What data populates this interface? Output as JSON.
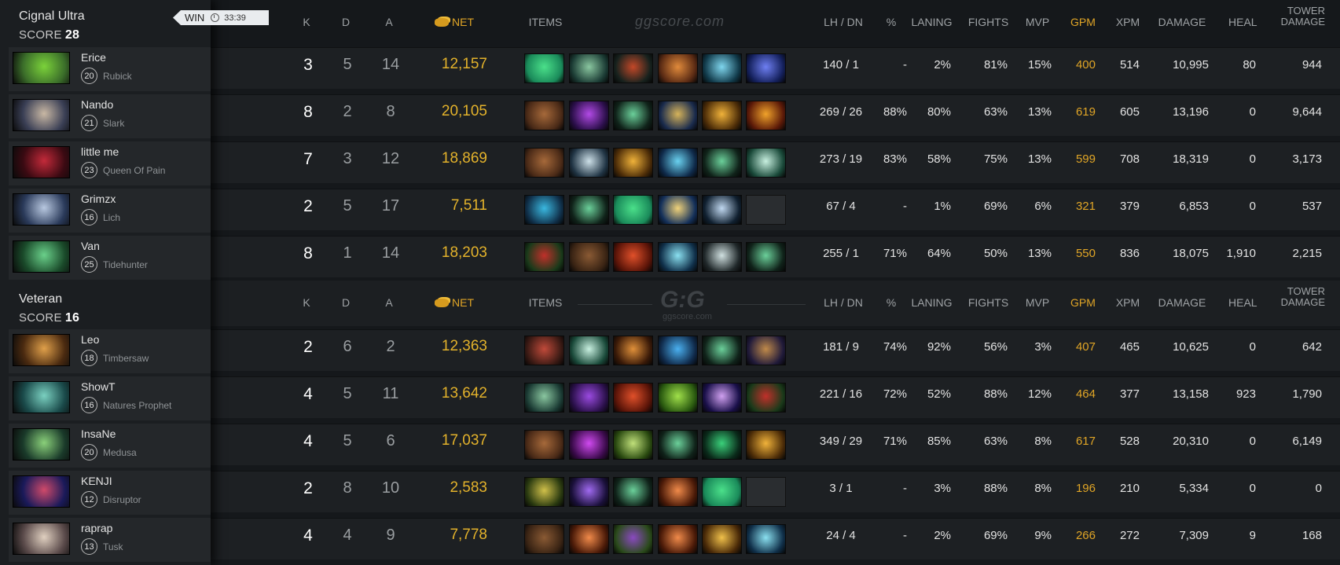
{
  "teams": [
    {
      "name": "Cignal Ultra",
      "score_label": "SCORE",
      "score": "28",
      "result": "WIN",
      "duration": "33:39",
      "players": [
        {
          "name": "Erice",
          "level": "20",
          "hero": "Rubick",
          "k": "3",
          "d": "5",
          "a": "14",
          "net": "12,157",
          "lhdn": "140  /  1",
          "pct": "-",
          "laning": "2%",
          "fights": "81%",
          "mvp": "15%",
          "gpm": "400",
          "xpm": "514",
          "damage": "10,995",
          "heal": "80",
          "tower": "944",
          "avatar_colors": [
            "#3b6e2a",
            "#7bd23a"
          ],
          "items": [
            [
              "#1a8a5a",
              "#4be08a"
            ],
            [
              "#1b3b34",
              "#8ac7a0"
            ],
            [
              "#17221e",
              "#c34828"
            ],
            [
              "#5b2b14",
              "#e08a3b"
            ],
            [
              "#113a4a",
              "#7fd6ee"
            ],
            [
              "#14205c",
              "#6e7ff2"
            ]
          ]
        },
        {
          "name": "Nando",
          "level": "21",
          "hero": "Slark",
          "k": "8",
          "d": "2",
          "a": "8",
          "net": "20,105",
          "lhdn": "269  /  26",
          "pct": "88%",
          "laning": "80%",
          "fights": "63%",
          "mvp": "13%",
          "gpm": "619",
          "xpm": "605",
          "damage": "13,196",
          "heal": "0",
          "tower": "9,644",
          "avatar_colors": [
            "#3a3f55",
            "#c9b8a4"
          ],
          "items": [
            [
              "#4a2a17",
              "#a6693a"
            ],
            [
              "#2b0f4a",
              "#b24ae6"
            ],
            [
              "#10231a",
              "#6bd09a"
            ],
            [
              "#1a2b4d",
              "#d6b35a"
            ],
            [
              "#4d2d08",
              "#f0b23a"
            ],
            [
              "#5c1a08",
              "#f0a22a"
            ]
          ]
        },
        {
          "name": "little me",
          "level": "23",
          "hero": "Queen Of Pain",
          "k": "7",
          "d": "3",
          "a": "12",
          "net": "18,869",
          "lhdn": "273  /  19",
          "pct": "83%",
          "laning": "58%",
          "fights": "75%",
          "mvp": "13%",
          "gpm": "599",
          "xpm": "708",
          "damage": "18,319",
          "heal": "0",
          "tower": "3,173",
          "avatar_colors": [
            "#3a0a12",
            "#c32a3a"
          ],
          "items": [
            [
              "#4a2a17",
              "#a6693a"
            ],
            [
              "#203444",
              "#cde0e8"
            ],
            [
              "#4d2d08",
              "#f0b23a"
            ],
            [
              "#0f2a4a",
              "#6ad2f0"
            ],
            [
              "#10231a",
              "#6bd09a"
            ],
            [
              "#1a4a3a",
              "#c8f0e0"
            ]
          ]
        },
        {
          "name": "Grimzx",
          "level": "16",
          "hero": "Lich",
          "k": "2",
          "d": "5",
          "a": "17",
          "net": "7,511",
          "lhdn": "67  /  4",
          "pct": "-",
          "laning": "1%",
          "fights": "69%",
          "mvp": "6%",
          "gpm": "321",
          "xpm": "379",
          "damage": "6,853",
          "heal": "0",
          "tower": "537",
          "avatar_colors": [
            "#2a3a5a",
            "#b8c8e0"
          ],
          "items": [
            [
              "#10304a",
              "#3ab8e0"
            ],
            [
              "#10231a",
              "#6bd09a"
            ],
            [
              "#1a8a5a",
              "#4be08a"
            ],
            [
              "#14305a",
              "#f0d27a"
            ],
            [
              "#102030",
              "#c0d8f0"
            ],
            [
              "#2a2d30",
              "#2a2d30"
            ]
          ],
          "empty_last": true
        },
        {
          "name": "Van",
          "level": "25",
          "hero": "Tidehunter",
          "k": "8",
          "d": "1",
          "a": "14",
          "net": "18,203",
          "lhdn": "255  /  1",
          "pct": "71%",
          "laning": "64%",
          "fights": "50%",
          "mvp": "13%",
          "gpm": "550",
          "xpm": "836",
          "damage": "18,075",
          "heal": "1,910",
          "tower": "2,215",
          "avatar_colors": [
            "#1a4a2a",
            "#6ad08a"
          ],
          "items": [
            [
              "#1a3a1a",
              "#c0302a"
            ],
            [
              "#3a2414",
              "#8a5a34"
            ],
            [
              "#5a1408",
              "#e0502a"
            ],
            [
              "#10304a",
              "#8ae0f0"
            ],
            [
              "#20282a",
              "#d0e0e0"
            ],
            [
              "#10231a",
              "#6bd09a"
            ]
          ]
        }
      ]
    },
    {
      "name": "Veteran",
      "score_label": "SCORE",
      "score": "16",
      "players": [
        {
          "name": "Leo",
          "level": "18",
          "hero": "Timbersaw",
          "k": "2",
          "d": "6",
          "a": "2",
          "net": "12,363",
          "lhdn": "181  /  9",
          "pct": "74%",
          "laning": "92%",
          "fights": "56%",
          "mvp": "3%",
          "gpm": "407",
          "xpm": "465",
          "damage": "10,625",
          "heal": "0",
          "tower": "642",
          "avatar_colors": [
            "#4a2a10",
            "#e0a04a"
          ],
          "items": [
            [
              "#3a1a14",
              "#c04a3a"
            ],
            [
              "#1a4a3a",
              "#c8f0e0"
            ],
            [
              "#3a1a08",
              "#e0903a"
            ],
            [
              "#102a4a",
              "#4ab0f0"
            ],
            [
              "#10231a",
              "#6bd09a"
            ],
            [
              "#201a3a",
              "#c08a4a"
            ]
          ]
        },
        {
          "name": "ShowT",
          "level": "16",
          "hero": "Natures Prophet",
          "k": "4",
          "d": "5",
          "a": "11",
          "net": "13,642",
          "lhdn": "221  /  16",
          "pct": "72%",
          "laning": "52%",
          "fights": "88%",
          "mvp": "12%",
          "gpm": "464",
          "xpm": "377",
          "damage": "13,158",
          "heal": "923",
          "tower": "1,790",
          "avatar_colors": [
            "#1a4a4a",
            "#7ad0c0"
          ],
          "items": [
            [
              "#1b3b34",
              "#8ac7a0"
            ],
            [
              "#2a104a",
              "#9a4ae0"
            ],
            [
              "#5a1408",
              "#e0502a"
            ],
            [
              "#2a5a10",
              "#a0e04a"
            ],
            [
              "#1a104a",
              "#d0a0f0"
            ],
            [
              "#1a3a1a",
              "#c0302a"
            ]
          ]
        },
        {
          "name": "InsaNe",
          "level": "20",
          "hero": "Medusa",
          "k": "4",
          "d": "5",
          "a": "6",
          "net": "17,037",
          "lhdn": "349  /  29",
          "pct": "71%",
          "laning": "85%",
          "fights": "63%",
          "mvp": "8%",
          "gpm": "617",
          "xpm": "528",
          "damage": "20,310",
          "heal": "0",
          "tower": "6,149",
          "avatar_colors": [
            "#1a3a2a",
            "#8ad07a"
          ],
          "items": [
            [
              "#4a2a17",
              "#a6693a"
            ],
            [
              "#3a0a4a",
              "#d04af0"
            ],
            [
              "#2a4a10",
              "#c0e07a"
            ],
            [
              "#10231a",
              "#6bd09a"
            ],
            [
              "#0a2a1a",
              "#3ad07a"
            ],
            [
              "#4d2d08",
              "#f0b23a"
            ]
          ]
        },
        {
          "name": "KENJI",
          "level": "12",
          "hero": "Disruptor",
          "k": "2",
          "d": "8",
          "a": "10",
          "net": "2,583",
          "lhdn": "3  /  1",
          "pct": "-",
          "laning": "3%",
          "fights": "88%",
          "mvp": "8%",
          "gpm": "196",
          "xpm": "210",
          "damage": "5,334",
          "heal": "0",
          "tower": "0",
          "avatar_colors": [
            "#1a1a5a",
            "#d04a6a"
          ],
          "items": [
            [
              "#2a3a10",
              "#d0c04a"
            ],
            [
              "#1a103a",
              "#a06af0"
            ],
            [
              "#10231a",
              "#6bd09a"
            ],
            [
              "#4a1a08",
              "#f08a4a"
            ],
            [
              "#1a8a5a",
              "#4be08a"
            ],
            [
              "#2a2d30",
              "#2a2d30"
            ]
          ],
          "empty_last": true
        },
        {
          "name": "raprap",
          "level": "13",
          "hero": "Tusk",
          "k": "4",
          "d": "4",
          "a": "9",
          "net": "7,778",
          "lhdn": "24  /  4",
          "pct": "-",
          "laning": "2%",
          "fights": "69%",
          "mvp": "9%",
          "gpm": "266",
          "xpm": "272",
          "damage": "7,309",
          "heal": "9",
          "tower": "168",
          "avatar_colors": [
            "#5a4a4a",
            "#e0d0c0"
          ],
          "items": [
            [
              "#3a2414",
              "#8a5a34"
            ],
            [
              "#4a1a08",
              "#f08a4a"
            ],
            [
              "#2a4a1a",
              "#8a4ac0"
            ],
            [
              "#4a1a08",
              "#f08a4a"
            ],
            [
              "#4a2a08",
              "#f0c04a"
            ],
            [
              "#10304a",
              "#8ae0f0"
            ],
            [
              "#4a1a08",
              "#f08a4a"
            ]
          ]
        }
      ]
    }
  ],
  "headers": {
    "k": "K",
    "d": "D",
    "a": "A",
    "net": "NET",
    "items": "ITEMS",
    "lhdn": "LH  /  DN",
    "pct": "%",
    "laning": "LANING",
    "fights": "FIGHTS",
    "mvp": "MVP",
    "gpm": "GPM",
    "xpm": "XPM",
    "damage": "DAMAGE",
    "heal": "HEAL",
    "tower": "TOWER\nDAMAGE"
  },
  "watermark": "ggscore.com",
  "logo": "G:G",
  "logo_sub": "ggscore.com",
  "colors": {
    "gold": "#e0a526",
    "net": "#e3b22b",
    "panel": "#1b1e21",
    "row": "#1d2023"
  }
}
